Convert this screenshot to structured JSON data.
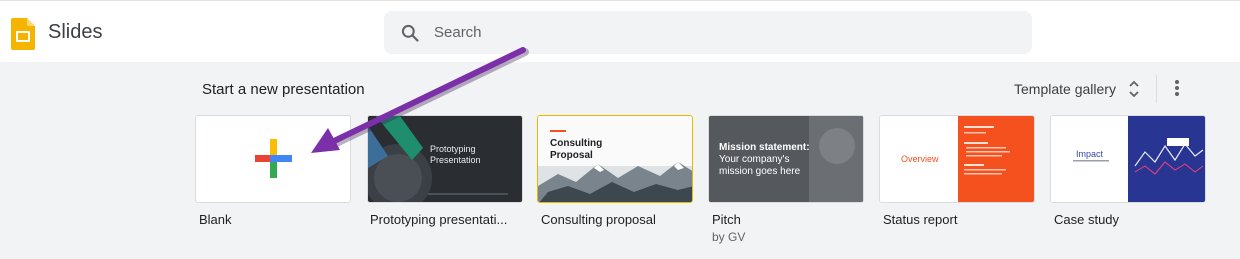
{
  "app": {
    "name": "Slides"
  },
  "search": {
    "placeholder": "Search"
  },
  "section": {
    "title": "Start a new presentation",
    "gallery_label": "Template gallery"
  },
  "templates": [
    {
      "label": "Blank"
    },
    {
      "label": "Prototyping presentati...",
      "thumb_title": "Prototyping Presentation"
    },
    {
      "label": "Consulting proposal",
      "thumb_title": "Consulting Proposal"
    },
    {
      "label": "Pitch",
      "sublabel": "by GV",
      "thumb_title": "Mission statement:",
      "thumb_body": "Your company's mission goes here"
    },
    {
      "label": "Status report",
      "thumb_title": "Overview"
    },
    {
      "label": "Case study",
      "thumb_title": "Impact"
    }
  ],
  "colors": {
    "accent_orange": "#f4511e",
    "case_blue": "#283593",
    "arrow_purple": "#7b2fa8",
    "slides_yellow": "#f4b400"
  }
}
